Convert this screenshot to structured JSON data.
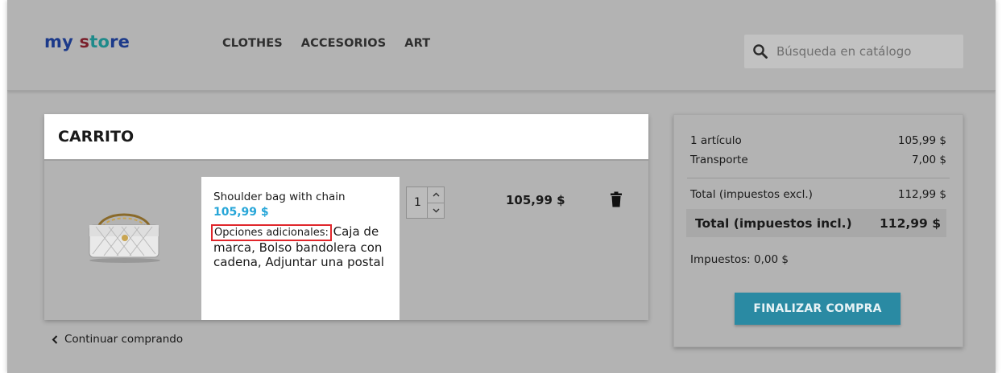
{
  "header": {
    "logo": {
      "part1": "my",
      "part2": "s",
      "part3": "to",
      "part4": "re"
    },
    "nav": [
      "CLOTHES",
      "ACCESORIOS",
      "ART"
    ],
    "search": {
      "placeholder": "Búsqueda en catálogo",
      "icon": "search-icon"
    }
  },
  "cart": {
    "title": "CARRITO",
    "item": {
      "name": "Shoulder bag with chain",
      "price": "105,99 $",
      "options_label": "Opciones adicionales:",
      "options_value": "Caja de marca, Bolso bandolera con cadena, Adjuntar una postal",
      "quantity": "1",
      "line_total": "105,99 $",
      "image": "white-quilted-shoulder-bag",
      "delete_icon": "trash-icon"
    },
    "continue_label": "Continuar comprando"
  },
  "summary": {
    "items_label": "1 artículo",
    "items_value": "105,99 $",
    "shipping_label": "Transporte",
    "shipping_value": "7,00 $",
    "total_excl_label": "Total (impuestos excl.)",
    "total_excl_value": "112,99 $",
    "total_incl_label": "Total (impuestos incl.)",
    "total_incl_value": "112,99 $",
    "taxes_label": "Impuestos: 0,00 $",
    "checkout_label": "FINALIZAR COMPRA"
  },
  "colors": {
    "accent": "#27a6d8",
    "checkout": "#2a8aa3",
    "highlight": "#e0262b",
    "overlay": "#b3b3b3"
  }
}
